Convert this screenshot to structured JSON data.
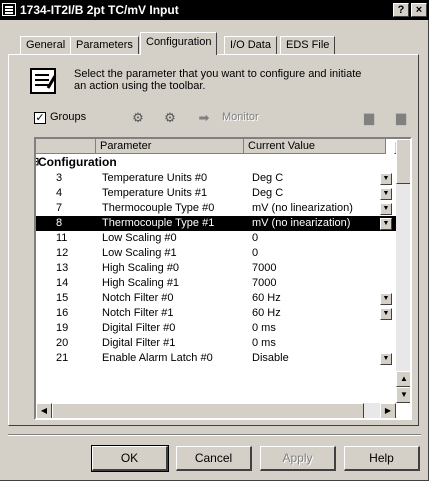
{
  "window": {
    "title": "1734-IT2I/B 2pt TC/mV Input",
    "help_label": "?",
    "close_label": "×"
  },
  "tabs": [
    {
      "label": "General"
    },
    {
      "label": "Parameters"
    },
    {
      "label": "Configuration"
    },
    {
      "label": "I/O Data"
    },
    {
      "label": "EDS File"
    }
  ],
  "info": {
    "text": "Select the parameter that you want to configure and initiate an action using the toolbar."
  },
  "toolbar": {
    "groups_checked": true,
    "groups_label": "Groups",
    "monitor_label": "Monitor"
  },
  "grid": {
    "columns": [
      "Parameter",
      "Current Value"
    ],
    "group_label": "Configuration",
    "rows": [
      {
        "num": "3",
        "param": "Temperature Units #0",
        "value": "Deg C",
        "dropdown": true
      },
      {
        "num": "4",
        "param": "Temperature Units #1",
        "value": "Deg C",
        "dropdown": true
      },
      {
        "num": "7",
        "param": "Thermocouple Type #0",
        "value": "mV (no linearization)",
        "dropdown": true
      },
      {
        "num": "8",
        "param": "Thermocouple Type #1",
        "value": "mV (no inearization)",
        "dropdown": true,
        "selected": true
      },
      {
        "num": "11",
        "param": "Low Scaling #0",
        "value": "0",
        "dropdown": false
      },
      {
        "num": "12",
        "param": "Low Scaling #1",
        "value": "0",
        "dropdown": false
      },
      {
        "num": "13",
        "param": "High Scaling #0",
        "value": "7000",
        "dropdown": false
      },
      {
        "num": "14",
        "param": "High Scaling #1",
        "value": "7000",
        "dropdown": false
      },
      {
        "num": "15",
        "param": "Notch Filter #0",
        "value": "60 Hz",
        "dropdown": true
      },
      {
        "num": "16",
        "param": "Notch Filter #1",
        "value": "60 Hz",
        "dropdown": true
      },
      {
        "num": "19",
        "param": "Digital Filter #0",
        "value": "0 ms",
        "dropdown": false
      },
      {
        "num": "20",
        "param": "Digital Filter #1",
        "value": "0 ms",
        "dropdown": false
      },
      {
        "num": "21",
        "param": "Enable Alarm Latch #0",
        "value": "Disable",
        "dropdown": true
      }
    ]
  },
  "buttons": {
    "ok": "OK",
    "cancel": "Cancel",
    "apply": "Apply",
    "help": "Help"
  }
}
